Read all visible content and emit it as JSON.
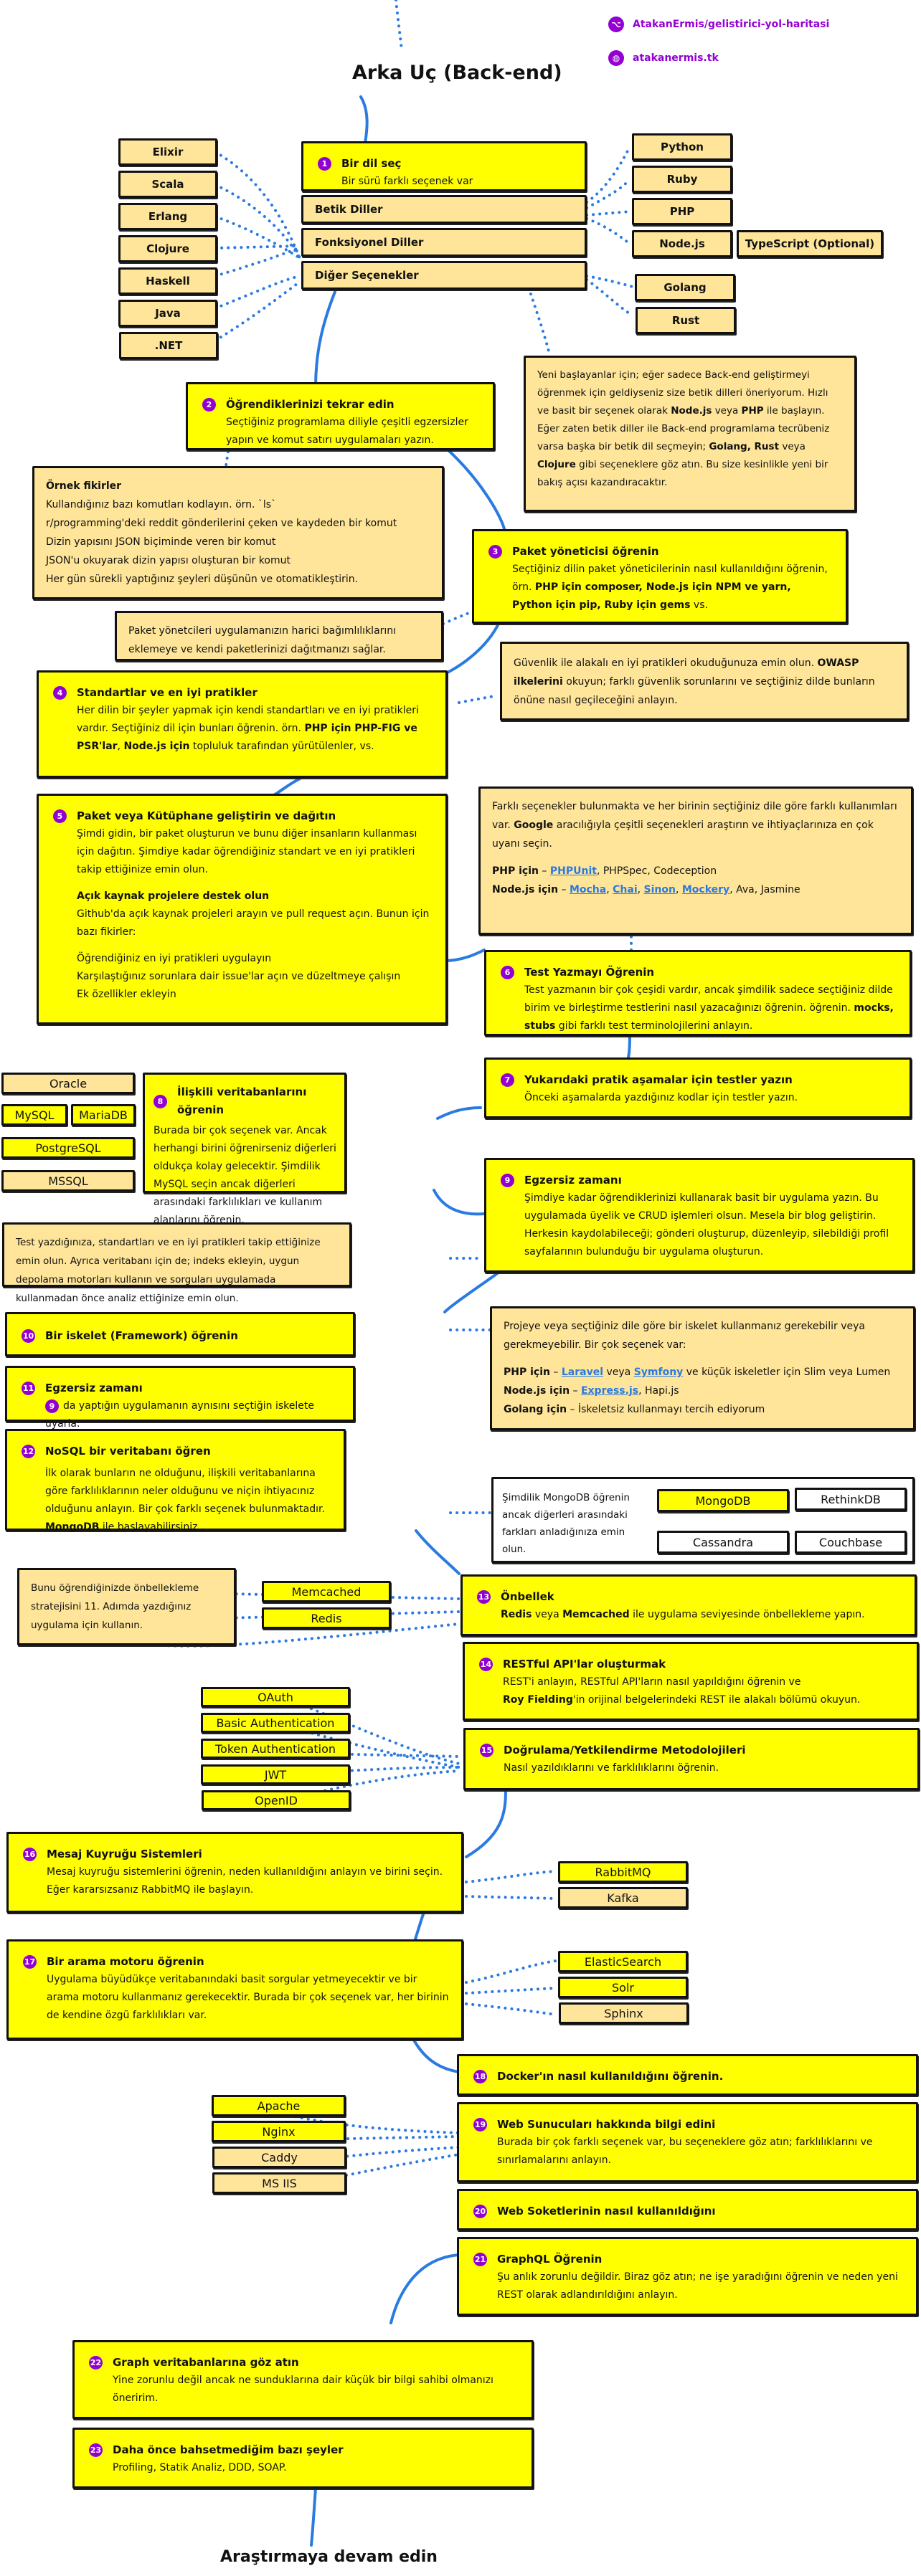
{
  "title": "Arka Uç (Back-end)",
  "footer": "Araştırmaya devam edin",
  "links": {
    "github": "AtakanErmis/gelistirici-yol-haritasi",
    "website": "atakanermis.tk",
    "github_icon": "github-icon",
    "website_icon": "globe-icon"
  },
  "colors": {
    "step": "#ffff00",
    "note": "#ffe599",
    "badge": "#9400d3",
    "connector": "#2a7ae2",
    "link": "#2a7ae2"
  },
  "languages": {
    "left": [
      "Elixir",
      "Scala",
      "Erlang",
      "Clojure",
      "Haskell",
      "Java",
      ".NET"
    ],
    "categories": [
      "Betik Diller",
      "Fonksiyonel Diller",
      "Diğer Seçenekler"
    ],
    "scripting": [
      "Python",
      "Ruby",
      "PHP",
      "Node.js"
    ],
    "typescript": "TypeScript (Optional)",
    "other": [
      "Golang",
      "Rust"
    ]
  },
  "steps": [
    {
      "num": "1",
      "title": "Bir dil seç",
      "body": "Bir sürü farklı seçenek var"
    },
    {
      "num": "2",
      "title": "Öğrendiklerinizi tekrar edin",
      "body": "Seçtiğiniz programlama diliyle çeşitli egzersizler yapın ve komut satırı uygulamaları yazın."
    },
    {
      "num": "3",
      "title": "Paket yöneticisi öğrenin",
      "body_pre": "Seçtiğiniz dilin paket yöneticilerinin nasıl kullanıldığını öğrenin, örn. ",
      "body_bold": "PHP için composer, Node.js için NPM ve yarn, Python için pip, Ruby için gems",
      "body_post": " vs."
    },
    {
      "num": "4",
      "title": "Standartlar ve en iyi pratikler",
      "body_pre": "Her dilin bir şeyler yapmak için kendi standartları ve en iyi pratikleri vardır. Seçtiğiniz dil için bunları öğrenin. örn. ",
      "body_bold1": "PHP için PHP-FIG ve PSR'lar",
      "body_mid": ", ",
      "body_bold2": "Node.js için",
      "body_post": " topluluk tarafından yürütülenler, vs."
    },
    {
      "num": "5",
      "title": "Paket veya Kütüphane geliştirin ve dağıtın",
      "body": "Şimdi gidin, bir paket oluşturun ve bunu diğer insanların kullanması için dağıtın. Şimdiye kadar öğrendiğiniz standart ve en iyi pratikleri takip ettiğinize emin olun.",
      "subtitle": "Açık kaynak projelere destek olun",
      "sub_body": "Github'da açık kaynak projeleri arayın ve pull request açın. Bunun için bazı fikirler:",
      "ideas": [
        "Öğrendiğiniz en iyi pratikleri uygulayın",
        "Karşılaştığınız sorunlara dair issue'lar açın ve düzeltmeye çalışın",
        "Ek özellikler ekleyin"
      ]
    },
    {
      "num": "6",
      "title": "Test Yazmayı Öğrenin",
      "body_pre": "Test yazmanın bir çok çeşidi vardır, ancak şimdilik sadece seçtiğiniz dilde birim ve birleştirme testlerini nasıl yazacağınızı öğrenin. öğrenin. ",
      "body_bold": "mocks, stubs",
      "body_post": " gibi farklı test terminolojilerini anlayın."
    },
    {
      "num": "7",
      "title": "Yukarıdaki pratik aşamalar için testler yazın",
      "body": "Önceki aşamalarda yazdığınız kodlar için testler yazın."
    },
    {
      "num": "8",
      "title": "İlişkili veritabanlarını öğrenin",
      "body": "Burada bir çok seçenek var. Ancak herhangi birini öğrenirseniz diğerleri oldukça kolay gelecektir. Şimdilik MySQL seçin ancak diğerleri arasındaki farklılıkları ve kullanım alanlarını öğrenin."
    },
    {
      "num": "9",
      "title": "Egzersiz zamanı",
      "body": "Şimdiye kadar öğrendiklerinizi kullanarak basit bir uygulama yazın. Bu uygulamada üyelik ve CRUD işlemleri olsun. Mesela bir blog geliştirin. Herkesin kaydolabileceği; gönderi oluşturup, düzenleyip, silebildiği profil sayfalarının bulunduğu bir uygulama oluşturun."
    },
    {
      "num": "10",
      "title": "Bir iskelet (Framework) öğrenin"
    },
    {
      "num": "11",
      "title": "Egzersiz zamanı",
      "ref": "9",
      "body": "da yaptığın uygulamanın aynısını seçtiğin iskelete uyarla."
    },
    {
      "num": "12",
      "title": "NoSQL bir veritabanı öğren",
      "body_pre": "İlk olarak bunların ne olduğunu, ilişkili veritabanlarına göre farklılıklarının neler olduğunu ve niçin ihtiyacınız olduğunu anlayın. Bir çok farklı seçenek bulunmaktadır. ",
      "body_bold": "MongoDB",
      "body_post": " ile başlayabilirsiniz."
    },
    {
      "num": "13",
      "title": "Önbellek",
      "body_bold1": "Redis",
      "body_mid": " veya ",
      "body_bold2": "Memcached",
      "body_post": " ile uygulama seviyesinde önbellekleme yapın."
    },
    {
      "num": "14",
      "title": "RESTful API'lar oluşturmak",
      "body": "REST'i anlayın, RESTful API'ların nasıl yapıldığını öğrenin ve",
      "body_bold": "Roy Fielding",
      "body_post": "'in orijinal belgelerindeki REST ile alakalı bölümü okuyun."
    },
    {
      "num": "15",
      "title": "Doğrulama/Yetkilendirme Metodolojileri",
      "body": "Nasıl yazıldıklarını ve farklılıklarını öğrenin."
    },
    {
      "num": "16",
      "title": "Mesaj Kuyruğu Sistemleri",
      "body": "Mesaj kuyruğu sistemlerini öğrenin, neden kullanıldığını anlayın ve birini seçin. Eğer kararsızsanız RabbitMQ ile başlayın."
    },
    {
      "num": "17",
      "title": "Bir arama motoru öğrenin",
      "body": "Uygulama büyüdükçe veritabanındaki basit sorgular yetmeyecektir ve bir arama motoru kullanmanız gerekecektir. Burada bir çok seçenek var, her birinin de kendine özgü farklılıkları var."
    },
    {
      "num": "18",
      "title": "Docker'ın nasıl kullanıldığını öğrenin."
    },
    {
      "num": "19",
      "title": "Web Sunucuları hakkında bilgi edini",
      "body": "Burada bir çok farklı seçenek var, bu seçeneklere göz atın; farklılıklarını ve sınırlamalarını anlayın."
    },
    {
      "num": "20",
      "title": "Web Soketlerinin nasıl kullanıldığını"
    },
    {
      "num": "21",
      "title": "GraphQL Öğrenin",
      "body": "Şu anlık zorunlu değildir. Biraz göz atın; ne işe yaradığını öğrenin ve neden yeni REST olarak adlandırıldığını anlayın."
    },
    {
      "num": "22",
      "title": "Graph veritabanlarına göz atın",
      "body": "Yine zorunlu değil ancak ne sunduklarına dair küçük bir bilgi sahibi olmanızı öneririm."
    },
    {
      "num": "23",
      "title": "Daha önce bahsetmediğim bazı şeyler",
      "body": "Profiling, Statik Analiz, DDD, SOAP."
    }
  ],
  "notes": {
    "beginner": {
      "p1": "Yeni başlayanlar için; eğer sadece Back-end geliştirmeyi öğrenmek için geldiyseniz size betik dilleri öneriyorum. Hızlı ve basit bir seçenek olarak ",
      "b1": "Node.js",
      "p2": " veya ",
      "b2": "PHP",
      "p3": " ile başlayın. Eğer zaten betik diller ile Back-end programlama tecrübeniz varsa başka bir betik dil seçmeyin; ",
      "b3": "Golang, Rust",
      "p4": " veya ",
      "b4": "Clojure",
      "p5": " gibi seçeneklere göz atın. Bu size kesinlikle yeni bir bakış açısı kazandıracaktır."
    },
    "ideas": {
      "title": "Örnek fikirler",
      "items": [
        "Kullandığınız bazı komutları kodlayın. örn. `ls`",
        "r/programming'deki reddit gönderilerini çeken ve kaydeden bir komut",
        "Dizin yapısını JSON biçiminde veren bir komut",
        "JSON'u okuyarak dizin yapısı oluşturan bir komut",
        "Her gün sürekli yaptığınız şeyleri düşünün ve otomatikleştirin."
      ]
    },
    "package_managers": "Paket yönetcileri uygulamanızın harici bağımlılıklarını eklemeye ve kendi paketlerinizi dağıtmanızı sağlar.",
    "security": {
      "p1": "Güvenlik ile alakalı en iyi pratikleri okuduğunuza emin olun. ",
      "b1": "OWASP ilkelerini",
      "p2": " okuyun; farklı güvenlik sorunlarını ve seçtiğiniz dilde bunların önüne nasıl geçileceğini anlayın."
    },
    "testing": {
      "p1": "Farklı seçenekler bulunmakta ve her birinin seçtiğiniz dile göre farklı kullanımları var. ",
      "b1": "Google",
      "p2": " aracılığıyla çeşitli seçenekleri araştırın ve ihtiyaçlarınıza en çok uyanı seçin.",
      "php_label": "PHP için",
      "php_links": [
        "PHPUnit"
      ],
      "php_rest": ", PHPSpec, Codeception",
      "node_label": "Node.js için",
      "node_links": [
        "Mocha",
        "Chai",
        "Sinon",
        "Mockery"
      ],
      "node_rest": ", Ava, Jasmine",
      "dash": " – "
    },
    "db_practice": "Test yazdığınıza, standartları ve en iyi pratikleri takip ettiğinize emin olun. Ayrıca veritabanı için de; indeks ekleyin, uygun depolama motorları kullanın ve sorguları uygulamada kullanmadan önce analiz ettiğinize emin olun.",
    "framework": {
      "p1": "Projeye veya seçtiğiniz dile göre bir iskelet kullanmanız gerekebilir veya gerekmeyebilir. Bir çok seçenek var:",
      "php_label": "PHP için",
      "php_l1": "Laravel",
      "php_mid": " veya ",
      "php_l2": "Symfony",
      "php_rest": " ve küçük iskeletler için Slim veya Lumen",
      "node_label": "Node.js için",
      "node_l1": "Express.js",
      "node_rest": ", Hapi.js",
      "go_label": "Golang için",
      "go_rest": "İskeletsiz kullanmayı tercih ediyorum",
      "dash": " – "
    },
    "nosql": "Şimdilik MongoDB öğrenin ancak diğerleri arasındaki farkları anladığınıza emin olun.",
    "cache": "Bunu öğrendiğinizde önbellekleme stratejisini 11. Adımda yazdığınız uygulama için kullanın."
  },
  "databases": {
    "relational": [
      "Oracle",
      "MySQL",
      "MariaDB",
      "PostgreSQL",
      "MSSQL"
    ],
    "nosql": [
      "MongoDB",
      "RethinkDB",
      "Cassandra",
      "Couchbase"
    ]
  },
  "cache_tools": [
    "Memcached",
    "Redis"
  ],
  "auth_methods": [
    "OAuth",
    "Basic Authentication",
    "Token Authentication",
    "JWT",
    "OpenID"
  ],
  "queues": [
    "RabbitMQ",
    "Kafka"
  ],
  "search_engines": [
    "ElasticSearch",
    "Solr",
    "Sphinx"
  ],
  "web_servers": [
    "Apache",
    "Nginx",
    "Caddy",
    "MS IIS"
  ]
}
